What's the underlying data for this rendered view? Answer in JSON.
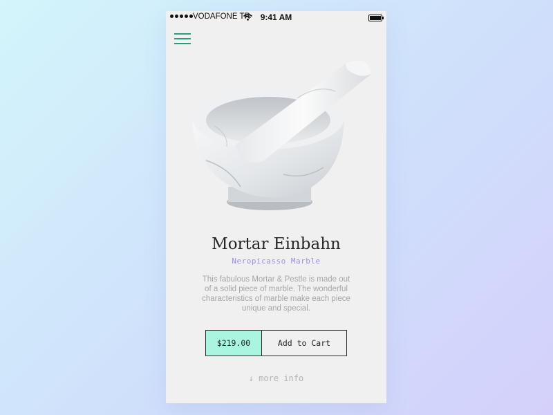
{
  "status_bar": {
    "carrier": "VODAFONE TR",
    "time": "9:41 AM",
    "signal_icon": "signal-dots-icon",
    "wifi_icon": "wifi-icon",
    "battery_icon": "battery-icon"
  },
  "nav": {
    "menu_icon": "hamburger-menu-icon"
  },
  "product": {
    "image": "marble-mortar-and-pestle",
    "name": "Mortar Einbahn",
    "maker": "Neropicasso Marble",
    "description": "This fabulous Mortar & Pestle is made out of a solid piece of marble. The wonderful characteristics of marble make each piece unique and special.",
    "price": "$219.00",
    "add_to_cart_label": "Add to Cart",
    "more_info_label": "↓ more info"
  },
  "colors": {
    "accent_green": "#2a9d7a",
    "price_bg": "#a9f5e0",
    "subtitle_purple": "#9c8cf0"
  }
}
